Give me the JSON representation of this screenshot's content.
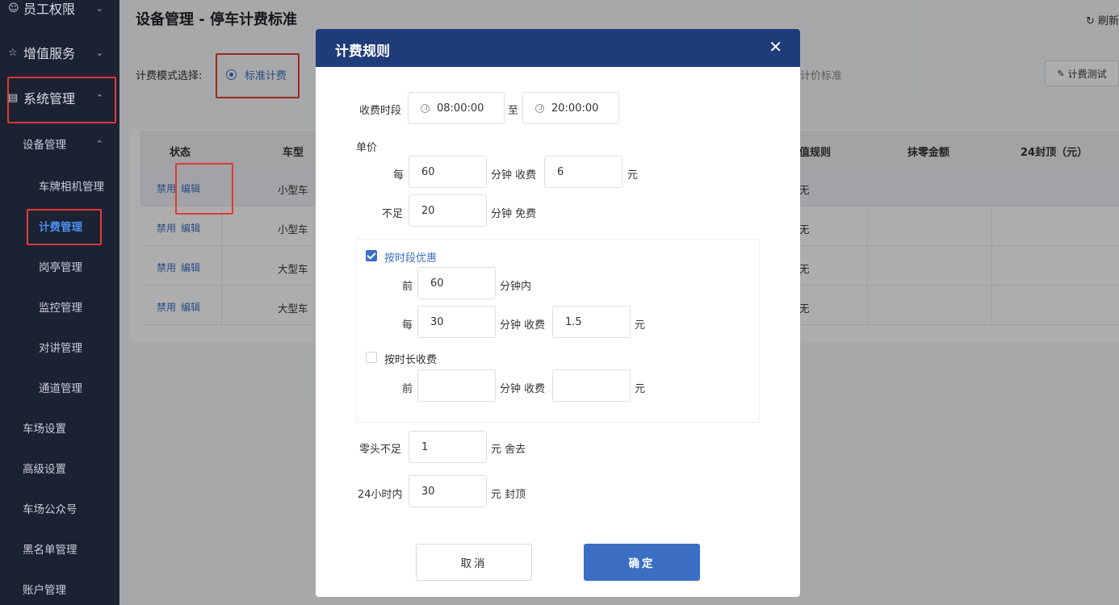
{
  "sidebar": {
    "items": [
      {
        "label": "员工权限",
        "icon": "user-key-icon"
      },
      {
        "label": "增值服务",
        "icon": "star-icon"
      },
      {
        "label": "系统管理",
        "icon": "system-icon"
      }
    ],
    "sub": {
      "label": "设备管理"
    },
    "sub2": [
      "车牌相机管理",
      "计费管理",
      "岗亭管理",
      "监控管理",
      "对讲管理",
      "通道管理"
    ],
    "more": [
      "车场设置",
      "高级设置",
      "车场公众号",
      "黑名单管理",
      "账户管理"
    ]
  },
  "page": {
    "title": "设备管理 - 停车计费标准",
    "refresh": "刷新",
    "mode_label": "计费模式选择:",
    "mode_option": "标准计费",
    "other_option": "计价标准",
    "test_button": "计费测试"
  },
  "table": {
    "headers": [
      "状态",
      "车型",
      "值规则",
      "抹零金额",
      "24封顶（元）"
    ],
    "rows": [
      {
        "action1": "禁用",
        "action2": "编辑",
        "car_type": "小型车",
        "rule": "无"
      },
      {
        "action1": "禁用",
        "action2": "编辑",
        "car_type": "小型车",
        "rule": "无"
      },
      {
        "action1": "禁用",
        "action2": "编辑",
        "car_type": "大型车",
        "rule": "无"
      },
      {
        "action1": "禁用",
        "action2": "编辑",
        "car_type": "大型车",
        "rule": "无"
      }
    ]
  },
  "modal": {
    "title": "计费规则",
    "time_label": "收费时段",
    "start_time": "08:00:00",
    "to": "至",
    "end_time": "20:00:00",
    "unit_price": "单价",
    "every": "每",
    "every_minutes": "60",
    "minute_charge": "分钟 收费",
    "every_fee": "6",
    "yuan": "元",
    "less_than": "不足",
    "free_minutes": "20",
    "minute_free": "分钟 免费",
    "period_discount": {
      "checked": true,
      "label": "按时段优惠",
      "first": "前",
      "first_minutes": "60",
      "minutes_within": "分钟内",
      "every": "每",
      "every_minutes": "30",
      "minute_charge": "分钟 收费",
      "fee": "1.5",
      "yuan": "元"
    },
    "duration_charge": {
      "checked": false,
      "label": "按时长收费",
      "first": "前",
      "minutes": "",
      "minute_charge": "分钟 收费",
      "fee": "",
      "yuan": "元"
    },
    "round_label": "零头不足",
    "round_value": "1",
    "round_suffix": "元 舍去",
    "cap_label": "24小时内",
    "cap_value": "30",
    "cap_suffix": "元 封顶",
    "cancel": "取消",
    "confirm": "确定"
  }
}
